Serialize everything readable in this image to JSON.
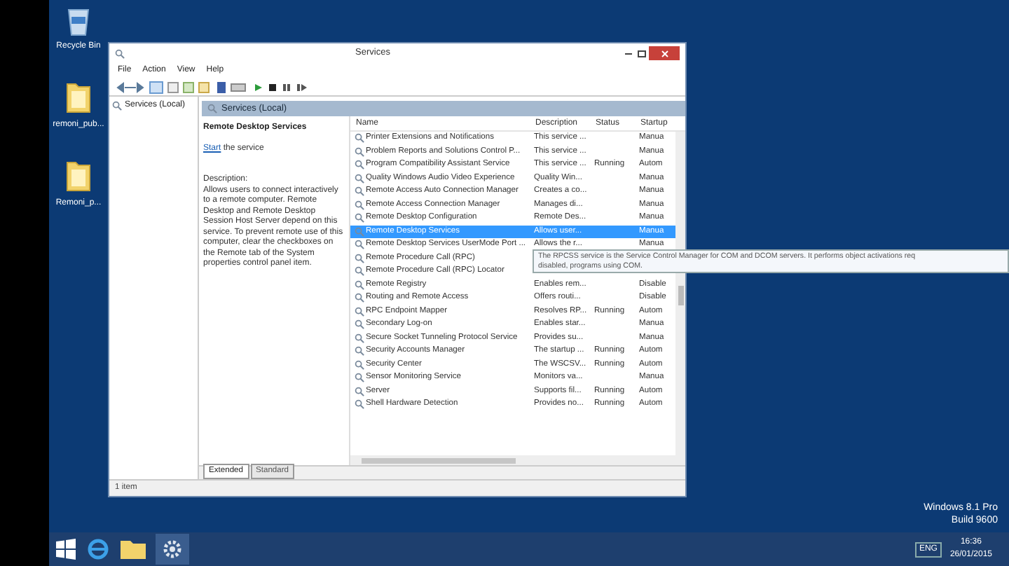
{
  "desktop_icons": [
    {
      "label": "Recycle Bin",
      "kind": "bin"
    },
    {
      "label": "remoni_pub...",
      "kind": "folder"
    },
    {
      "label": "Remoni_p...",
      "kind": "folder"
    }
  ],
  "window": {
    "title": "Services"
  },
  "menu": [
    "File",
    "Action",
    "View",
    "Help"
  ],
  "tree": {
    "item": "Services (Local)"
  },
  "panel_header": "Services (Local)",
  "detail": {
    "title": "Remote Desktop Services",
    "link": "Start",
    "link_rest": " the service",
    "description": "Description:\nAllows users to connect interactively to a remote computer. Remote Desktop and Remote Desktop Session Host Server depend on this service. To prevent remote use of this computer, clear the checkboxes on the Remote tab of the System properties control panel item."
  },
  "table": {
    "columns": [
      "Name",
      "Description",
      "Status",
      "Startup"
    ],
    "rows": [
      {
        "cells": [
          "Printer Extensions and Notifications",
          "This service ...",
          "",
          "Manua"
        ],
        "selected": false
      },
      {
        "cells": [
          "Problem Reports and Solutions Control P...",
          "This service ...",
          "",
          "Manua"
        ],
        "selected": false
      },
      {
        "cells": [
          "Program Compatibility Assistant Service",
          "This service ...",
          "Running",
          "Autom"
        ],
        "selected": false
      },
      {
        "cells": [
          "Quality Windows Audio Video Experience",
          "Quality Win...",
          "",
          "Manua"
        ],
        "selected": false
      },
      {
        "cells": [
          "Remote Access Auto Connection Manager",
          "Creates a co...",
          "",
          "Manua"
        ],
        "selected": false
      },
      {
        "cells": [
          "Remote Access Connection Manager",
          "Manages di...",
          "",
          "Manua"
        ],
        "selected": false
      },
      {
        "cells": [
          "Remote Desktop Configuration",
          "Remote Des...",
          "",
          "Manua"
        ],
        "selected": false
      },
      {
        "cells": [
          "Remote Desktop Services",
          "Allows user...",
          "",
          "Manua"
        ],
        "selected": true
      },
      {
        "cells": [
          "Remote Desktop Services UserMode Port ...",
          "Allows the r...",
          "",
          "Manua"
        ],
        "selected": false
      },
      {
        "cells": [
          "Remote Procedure Call (RPC)",
          "",
          "",
          ""
        ],
        "selected": false
      },
      {
        "cells": [
          "Remote Procedure Call (RPC) Locator",
          "",
          "",
          ""
        ],
        "selected": false
      },
      {
        "cells": [
          "Remote Registry",
          "Enables rem...",
          "",
          "Disable"
        ],
        "selected": false
      },
      {
        "cells": [
          "Routing and Remote Access",
          "Offers routi...",
          "",
          "Disable"
        ],
        "selected": false
      },
      {
        "cells": [
          "RPC Endpoint Mapper",
          "Resolves RP...",
          "Running",
          "Autom"
        ],
        "selected": false
      },
      {
        "cells": [
          "Secondary Log-on",
          "Enables star...",
          "",
          "Manua"
        ],
        "selected": false
      },
      {
        "cells": [
          "Secure Socket Tunneling Protocol Service",
          "Provides su...",
          "",
          "Manua"
        ],
        "selected": false
      },
      {
        "cells": [
          "Security Accounts Manager",
          "The startup ...",
          "Running",
          "Autom"
        ],
        "selected": false
      },
      {
        "cells": [
          "Security Center",
          "The WSCSV...",
          "Running",
          "Autom"
        ],
        "selected": false
      },
      {
        "cells": [
          "Sensor Monitoring Service",
          "Monitors va...",
          "",
          "Manua"
        ],
        "selected": false
      },
      {
        "cells": [
          "Server",
          "Supports fil...",
          "Running",
          "Autom"
        ],
        "selected": false
      },
      {
        "cells": [
          "Shell Hardware Detection",
          "Provides no...",
          "Running",
          "Autom"
        ],
        "selected": false
      }
    ]
  },
  "tooltip": {
    "lines": [
      "The RPCSS service is the Service Control Manager for COM and DCOM servers. It performs object activations req",
      "disabled, programs using COM."
    ]
  },
  "tabs": [
    {
      "label": "Extended",
      "selected": true
    },
    {
      "label": "Standard",
      "selected": false
    }
  ],
  "status_bar": "1 item",
  "os_watermark": [
    "Windows 8.1 Pro",
    "Build 9600"
  ],
  "tray": {
    "language": "ENG",
    "time": "16:36",
    "date": "26/01/2015"
  }
}
